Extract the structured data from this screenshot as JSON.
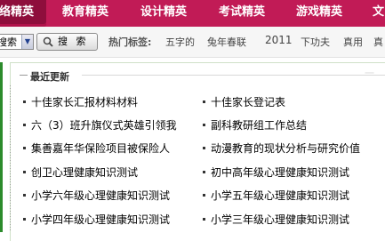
{
  "nav": {
    "items": [
      {
        "label": "络精英",
        "active": true
      },
      {
        "label": "教育精英"
      },
      {
        "label": "设计精英"
      },
      {
        "label": "考试精英"
      },
      {
        "label": "游戏精英"
      },
      {
        "label": "文"
      }
    ]
  },
  "search": {
    "select_value": "搜索",
    "button_label": "搜 索",
    "hot_label": "热门标签:",
    "tags": [
      "五字的",
      "兔年春联",
      "2011",
      "下功夫",
      "真用",
      "真"
    ]
  },
  "recent": {
    "title": "最近更新",
    "ghost": "一",
    "left_items": [
      "十佳家长汇报材料材料",
      "六（3）班升旗仪式英雄引领我",
      "集善嘉年华保险项目被保险人",
      "创卫心理健康知识测试",
      "小学六年级心理健康知识测试",
      "小学四年级心理健康知识测试"
    ],
    "right_items": [
      "十佳家长登记表",
      "副科教研组工作总结",
      "动漫教育的现状分析与研究价值",
      "初中高年级心理健康知识测试",
      "小学五年级心理健康知识测试",
      "小学三年级心理健康知识测试"
    ]
  },
  "colors": {
    "nav_bg": "#c11b56",
    "nav_active": "#8e0e3c",
    "accent_green": "#2c8b2c"
  },
  "icons": {
    "search_button": "magnifier-icon",
    "select_arrow": "chevron-down-icon"
  }
}
